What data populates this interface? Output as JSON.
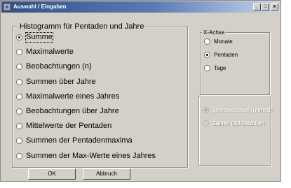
{
  "window": {
    "title": "Auswahl / Eingaben",
    "controls": {
      "minimize": "_",
      "maximize": "□",
      "close": "x"
    },
    "accent": "#2f4f86"
  },
  "histogram_group": {
    "label": "Histogramm für Pentaden und Jahre",
    "options": [
      {
        "label": "Summe",
        "checked": true
      },
      {
        "label": "Maximalwerte",
        "checked": false
      },
      {
        "label": "Beobachtungen (n)",
        "checked": false
      },
      {
        "label": "Summen über Jahre",
        "checked": false
      },
      {
        "label": "Maximalwerte eines Jahres",
        "checked": false
      },
      {
        "label": "Beobachtungen über Jahre",
        "checked": false
      },
      {
        "label": "Mittelwerte der Pentaden",
        "checked": false
      },
      {
        "label": "Summen der Pentadenmaxima",
        "checked": false
      },
      {
        "label": "Summen der Max-Werte eines Jahres",
        "checked": false
      }
    ]
  },
  "xachse_group": {
    "label": "X-Achse",
    "options": [
      {
        "label": "Monate",
        "checked": false
      },
      {
        "label": "Pentaden",
        "checked": true
      },
      {
        "label": "Tage",
        "checked": false
      }
    ]
  },
  "year_group": {
    "options": [
      {
        "label": "Jahreswechsel (normal)",
        "checked": true,
        "enabled": false
      },
      {
        "label": "Zählen (Jul-Dez/Jun)",
        "checked": false,
        "enabled": false
      }
    ]
  },
  "buttons": {
    "ok": "OK",
    "abbruch": "Abbruch"
  }
}
